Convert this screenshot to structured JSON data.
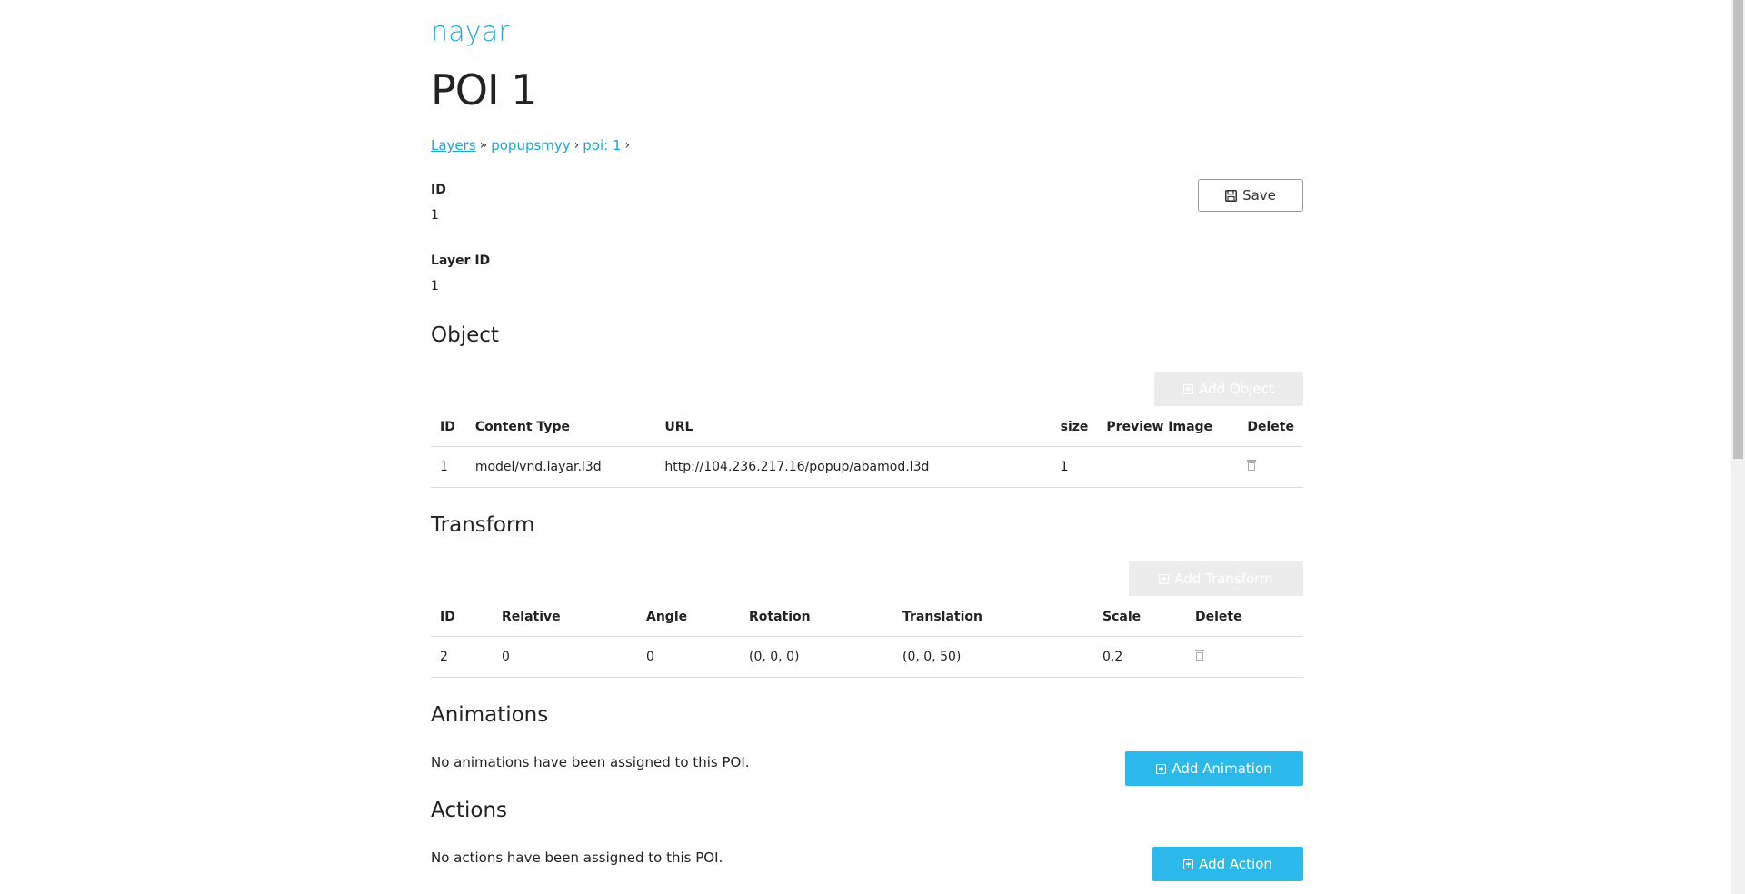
{
  "brand": "nayar",
  "page_title": "POI 1",
  "breadcrumb": {
    "layers_link": "Layers",
    "sep1": "»",
    "layer_name": "popupsmyy",
    "sep2": "›",
    "poi": "poi: 1",
    "sep3": "›"
  },
  "save_label": "Save",
  "fields": {
    "id_label": "ID",
    "id_value": "1",
    "layer_id_label": "Layer ID",
    "layer_id_value": "1"
  },
  "object_section": {
    "title": "Object",
    "add_label": "Add Object",
    "columns": [
      "ID",
      "Content Type",
      "URL",
      "size",
      "Preview Image",
      "Delete"
    ],
    "rows": [
      {
        "id": "1",
        "content_type": "model/vnd.layar.l3d",
        "url": "http://104.236.217.16/popup/abamod.l3d",
        "size": "1",
        "preview": ""
      }
    ]
  },
  "transform_section": {
    "title": "Transform",
    "add_label": "Add Transform",
    "columns": [
      "ID",
      "Relative",
      "Angle",
      "Rotation",
      "Translation",
      "Scale",
      "Delete"
    ],
    "rows": [
      {
        "id": "2",
        "relative": "0",
        "angle": "0",
        "rotation": "(0, 0, 0)",
        "translation": "(0, 0, 50)",
        "scale": "0.2"
      }
    ]
  },
  "animations_section": {
    "title": "Animations",
    "empty_text": "No animations have been assigned to this POI.",
    "add_label": "Add Animation"
  },
  "actions_section": {
    "title": "Actions",
    "empty_text": "No actions have been assigned to this POI.",
    "add_label": "Add Action"
  },
  "colors": {
    "accent": "#1ba8d6",
    "primary_button": "#2bb8ea",
    "disabled_button": "#ececec"
  }
}
